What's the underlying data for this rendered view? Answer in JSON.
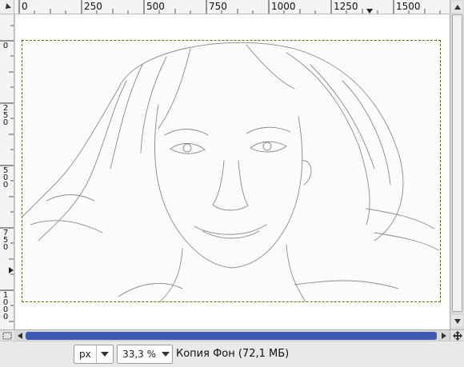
{
  "window": {
    "title": ""
  },
  "rulers": {
    "horizontal_ticks": [
      "0",
      "250",
      "500",
      "750",
      "1000",
      "1250",
      "1500"
    ],
    "vertical_ticks": [
      "0",
      "250",
      "500",
      "750",
      "1000"
    ]
  },
  "canvas": {
    "image_description": "pencil sketch portrait of a woman with shoulder-length hair"
  },
  "status_bar": {
    "unit": "px",
    "zoom": "33,3 %",
    "layer_info": "Копия Фон (72,1 МБ)"
  },
  "icons": {
    "corner": "pointer-arrow-icon",
    "navigate": "navigate-cross-icon"
  },
  "colors": {
    "scroll_accent": "#3d57b4",
    "selection_border": "#6b6b00"
  }
}
